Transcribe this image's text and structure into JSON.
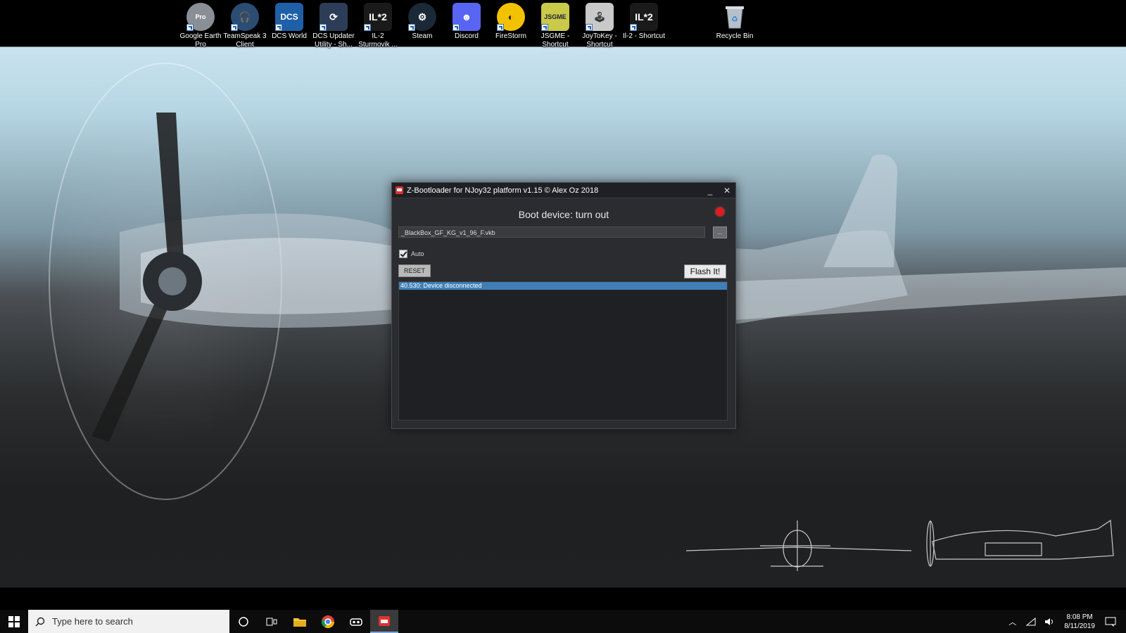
{
  "desktop": {
    "icons": [
      {
        "label": "Google Earth Pro",
        "badge": "Pro",
        "icon": "google-earth-icon",
        "color": "#8a8f96"
      },
      {
        "label": "TeamSpeak 3 Client",
        "icon": "teamspeak-icon",
        "color": "#2b4d74"
      },
      {
        "label": "DCS World",
        "badge": "DCS",
        "icon": "dcs-world-icon",
        "color": "#1f5fa8"
      },
      {
        "label": "DCS Updater Utility - Sh...",
        "icon": "dcs-updater-icon",
        "color": "#2d3d57"
      },
      {
        "label": "IL-2 Sturmovik ...",
        "badge": "IL*2",
        "icon": "il2-icon",
        "color": "#1a1a1a"
      },
      {
        "label": "Steam",
        "icon": "steam-icon",
        "color": "#1b2838"
      },
      {
        "label": "Discord",
        "icon": "discord-icon",
        "color": "#5865f2"
      },
      {
        "label": "FireStorm",
        "icon": "firestorm-icon",
        "color": "#f2c200"
      },
      {
        "label": "JSGME - Shortcut",
        "badge": "JSGME",
        "icon": "jsgme-icon",
        "color": "#c9c94a"
      },
      {
        "label": "JoyToKey - Shortcut",
        "icon": "joytokey-icon",
        "color": "#c9c9c9"
      },
      {
        "label": "Il-2 - Shortcut",
        "badge": "IL*2",
        "icon": "il2-shortcut-icon",
        "color": "#1a1a1a"
      },
      {
        "label": "Recycle Bin",
        "icon": "recycle-bin-icon",
        "color": "#9aa3ad"
      }
    ]
  },
  "window": {
    "title": "Z-Bootloader for NJoy32 platform v1.15 © Alex Oz 2018",
    "minimize_label": "_",
    "close_label": "✕",
    "boot_status": "Boot device: turn out",
    "led_color": "#e01b1b",
    "file_path": "_BlackBox_GF_KG_v1_96_F.vkb",
    "browse_label": "...",
    "auto_label": "Auto",
    "auto_checked": true,
    "reset_label": "RESET",
    "flash_label": "Flash It!",
    "log": [
      "40.530: Device disconnected"
    ]
  },
  "taskbar": {
    "search_placeholder": "Type here to search",
    "time": "8:08 PM",
    "date": "8/11/2019",
    "pinned": [
      "cortana-icon",
      "task-view-icon",
      "file-explorer-icon",
      "chrome-icon",
      "vr-headset-icon",
      "z-bootloader-icon"
    ]
  }
}
